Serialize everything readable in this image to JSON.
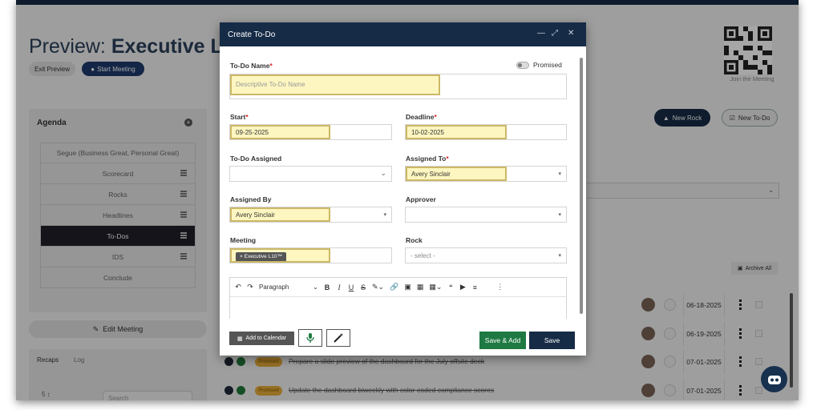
{
  "background": {
    "title_prefix": "Preview: ",
    "title_main": "Executive L",
    "exit_preview_label": "Exit Preview",
    "start_meeting_label": "Start Meeting",
    "join_label": "Join the Meeting",
    "agenda_title": "Agenda",
    "agenda_items": [
      {
        "label": "Segue (Business Great, Personal Great)",
        "active": false,
        "grid": false
      },
      {
        "label": "Scorecard",
        "active": false,
        "grid": true
      },
      {
        "label": "Rocks",
        "active": false,
        "grid": true
      },
      {
        "label": "Headlines",
        "active": false,
        "grid": true
      },
      {
        "label": "To-Dos",
        "active": true,
        "grid": true
      },
      {
        "label": "IDS",
        "active": false,
        "grid": true
      },
      {
        "label": "Conclude",
        "active": false,
        "grid": false
      }
    ],
    "edit_meeting_label": "Edit Meeting",
    "tabs": {
      "recaps": "Recaps",
      "log": "Log"
    },
    "recaps_page_value": "5",
    "search_placeholder": "Search",
    "new_rock_label": "New Rock",
    "new_todo_label": "New To-Do",
    "archive_all_label": "Archive All",
    "todo_rows": [
      {
        "text": "",
        "date": "06-18-2025",
        "badge": false
      },
      {
        "text": "",
        "date": "06-19-2025",
        "badge": false
      },
      {
        "text": "Prepare a slide preview of the dashboard for the July offsite deck",
        "date": "07-01-2025",
        "badge": true,
        "badge_label": "Promised"
      },
      {
        "text": "Update the dashboard biweekly with color-coded compliance scores",
        "date": "07-01-2025",
        "badge": true,
        "badge_label": "Promised"
      }
    ]
  },
  "modal": {
    "title": "Create To-Do",
    "promised_label": "Promised",
    "name": {
      "label": "To-Do Name",
      "required_mark": "*",
      "placeholder": "Descriptive To-Do Name"
    },
    "start": {
      "label": "Start",
      "required_mark": "*",
      "value": "09-25-2025"
    },
    "deadline": {
      "label": "Deadline",
      "required_mark": "*",
      "value": "10-02-2025"
    },
    "todo_assigned": {
      "label": "To-Do Assigned"
    },
    "assigned_to": {
      "label": "Assigned To",
      "required_mark": "*",
      "value": "Avery Sinclair"
    },
    "assigned_by": {
      "label": "Assigned By",
      "value": "Avery Sinclair"
    },
    "approver": {
      "label": "Approver"
    },
    "meeting": {
      "label": "Meeting",
      "chip": "Executive L10™"
    },
    "rock": {
      "label": "Rock",
      "placeholder": "- select -"
    },
    "editor": {
      "paragraph_label": "Paragraph"
    },
    "footer": {
      "add_to_calendar": "Add to Calendar",
      "save_add": "Save & Add",
      "save": "Save"
    }
  }
}
